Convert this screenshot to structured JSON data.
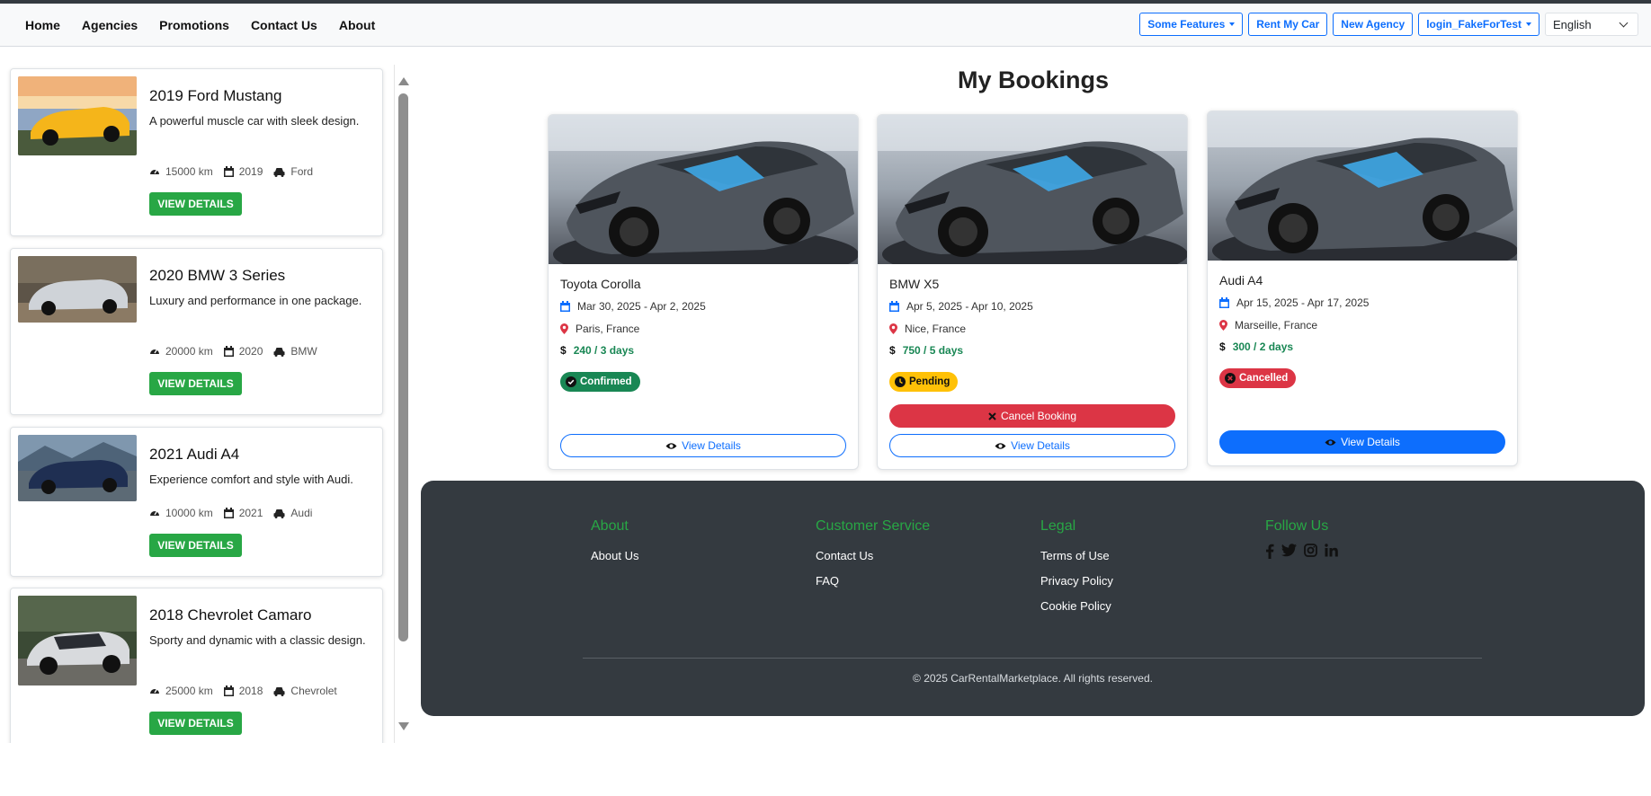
{
  "nav": {
    "links": [
      "Home",
      "Agencies",
      "Promotions",
      "Contact Us",
      "About"
    ],
    "some_features": "Some Features",
    "rent_my_car": "Rent My Car",
    "new_agency": "New Agency",
    "login": "login_FakeForTest",
    "language": "English"
  },
  "sidebar": {
    "cars": [
      {
        "title": "2019 Ford Mustang",
        "desc": "A powerful muscle car with sleek design.",
        "km": "15000 km",
        "year": "2019",
        "brand": "Ford",
        "button": "VIEW DETAILS"
      },
      {
        "title": "2020 BMW 3 Series",
        "desc": "Luxury and performance in one package.",
        "km": "20000 km",
        "year": "2020",
        "brand": "BMW",
        "button": "VIEW DETAILS"
      },
      {
        "title": "2021 Audi A4",
        "desc": "Experience comfort and style with Audi.",
        "km": "10000 km",
        "year": "2021",
        "brand": "Audi",
        "button": "VIEW DETAILS"
      },
      {
        "title": "2018 Chevrolet Camaro",
        "desc": "Sporty and dynamic with a classic design.",
        "km": "25000 km",
        "year": "2018",
        "brand": "Chevrolet",
        "button": "VIEW DETAILS"
      }
    ]
  },
  "main": {
    "title": "My Bookings",
    "bookings": [
      {
        "car": "Toyota Corolla",
        "dates": "Mar 30, 2025 - Apr 2, 2025",
        "location": "Paris, France",
        "price": "240 / 3 days",
        "status": "Confirmed",
        "view_label": "View Details"
      },
      {
        "car": "BMW X5",
        "dates": "Apr 5, 2025 - Apr 10, 2025",
        "location": "Nice, France",
        "price": "750 / 5 days",
        "status": "Pending",
        "cancel_label": "Cancel Booking",
        "view_label": "View Details"
      },
      {
        "car": "Audi A4",
        "dates": "Apr 15, 2025 - Apr 17, 2025",
        "location": "Marseille, France",
        "price": "300 / 2 days",
        "status": "Cancelled",
        "view_label": "View Details"
      }
    ]
  },
  "footer": {
    "about": {
      "heading": "About",
      "links": [
        "About Us"
      ]
    },
    "service": {
      "heading": "Customer Service",
      "links": [
        "Contact Us",
        "FAQ"
      ]
    },
    "legal": {
      "heading": "Legal",
      "links": [
        "Terms of Use",
        "Privacy Policy",
        "Cookie Policy"
      ]
    },
    "follow": {
      "heading": "Follow Us",
      "icons": [
        "facebook-icon",
        "twitter-icon",
        "instagram-icon",
        "linkedin-icon"
      ]
    },
    "copyright": "© 2025 CarRentalMarketplace. All rights reserved."
  },
  "colors": {
    "accent": "#0d6efd",
    "success": "#28a745",
    "danger": "#dc3545",
    "warning": "#ffc107",
    "footer_bg": "#343a40"
  }
}
